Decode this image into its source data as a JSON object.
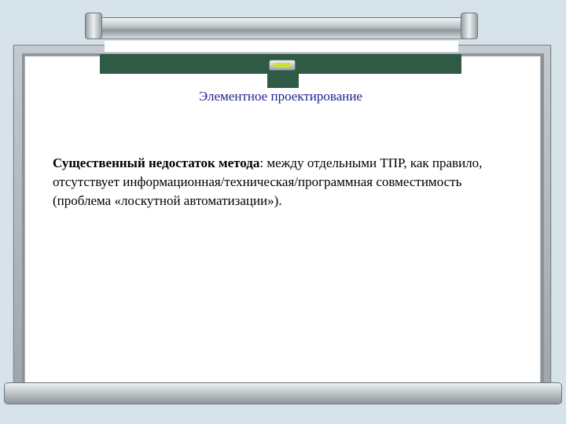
{
  "slide": {
    "title": "Элементное проектирование",
    "lead_bold": "Существенный недостаток метода",
    "lead_rest": ": между отдельными ТПР, как правило, отсутствует информационная/техническая/программная совместимость (проблема «лоскутной автоматизации»)."
  },
  "colors": {
    "title": "#1f1f8f",
    "board_green": "#2f5a45",
    "background": "#d6e3ea"
  },
  "icons": {
    "hanger": "board-hanger-icon"
  }
}
